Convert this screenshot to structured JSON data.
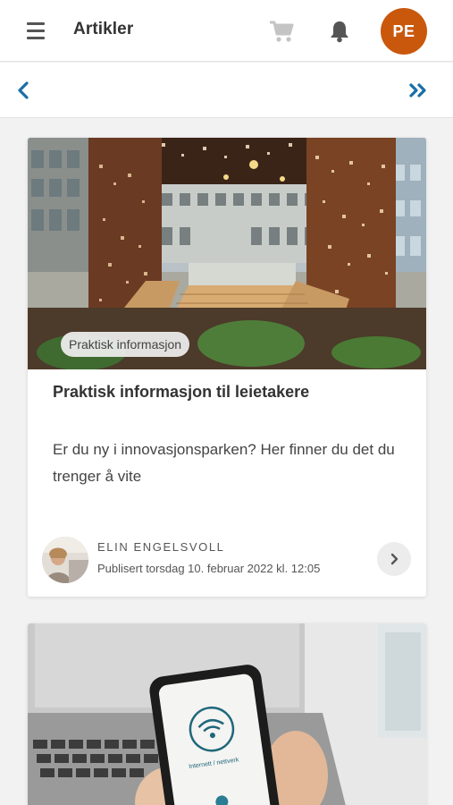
{
  "header": {
    "title": "Artikler",
    "avatar_initials": "PE",
    "avatar_color": "#c9580d",
    "icons": [
      "menu-icon",
      "cart-icon",
      "bell-icon"
    ]
  },
  "nav": {
    "icons": [
      "chevron-left-icon",
      "double-chevron-right-icon"
    ],
    "accent_color": "#1a6fa6"
  },
  "articles": [
    {
      "tag": "Praktisk informasjon",
      "title": "Praktisk informasjon til leietakere",
      "description": "Er du ny i innovasjonsparken? Her finner du det du trenger å vite",
      "author": "ELIN ENGELSVOLL",
      "published": "Publisert torsdag 10. februar 2022 kl. 12:05"
    },
    {
      "image_label": "Internett / nettverk"
    }
  ]
}
